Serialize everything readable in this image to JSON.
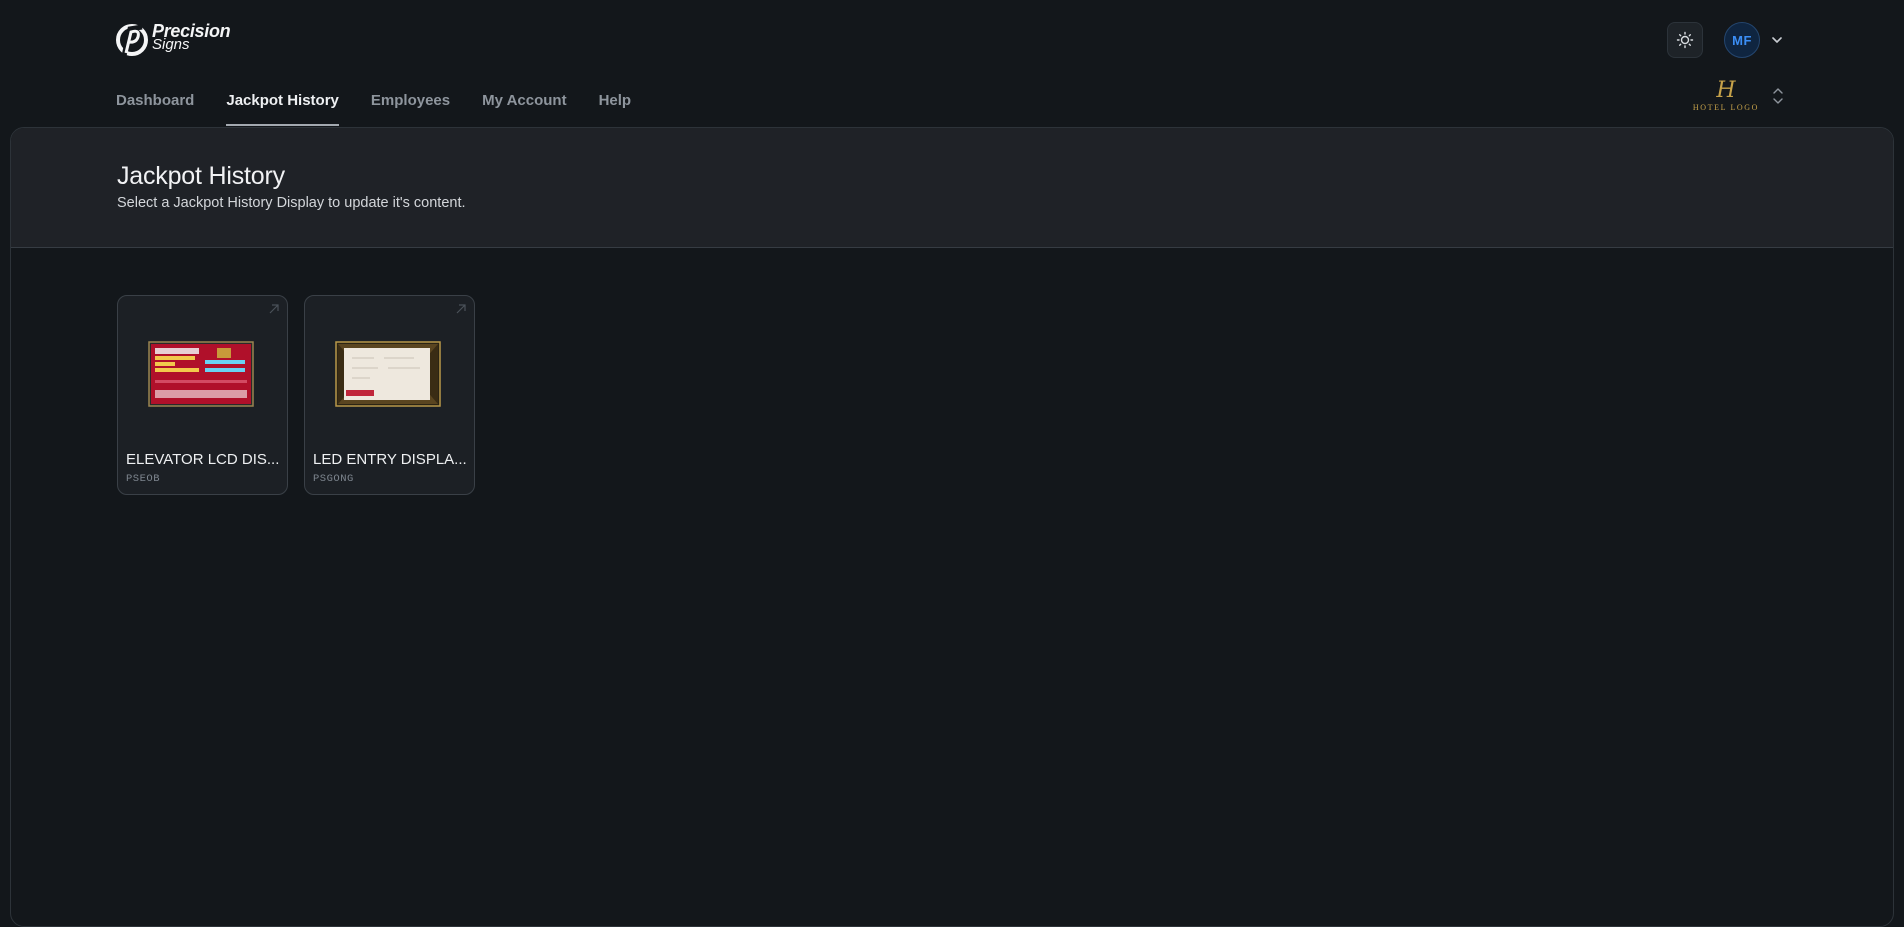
{
  "brand": {
    "line1": "Precision",
    "line2": "Signs"
  },
  "nav": {
    "items": [
      {
        "label": "Dashboard",
        "active": false
      },
      {
        "label": "Jackpot History",
        "active": true
      },
      {
        "label": "Employees",
        "active": false
      },
      {
        "label": "My Account",
        "active": false
      },
      {
        "label": "Help",
        "active": false
      }
    ]
  },
  "user": {
    "initials": "MF"
  },
  "property": {
    "logo_mark": "H",
    "logo_text": "HOTEL LOGO"
  },
  "page": {
    "title": "Jackpot History",
    "subtitle": "Select a Jackpot History Display to update it's content."
  },
  "displays": [
    {
      "name": "ELEVATOR LCD DIS...",
      "code": "PSEOB",
      "thumb_style": "red"
    },
    {
      "name": "LED ENTRY DISPLA...",
      "code": "PSGONG",
      "thumb_style": "gold"
    }
  ],
  "colors": {
    "accent_blue": "#3b8ef5",
    "gold": "#c6a24a",
    "bg": "#13171b"
  }
}
